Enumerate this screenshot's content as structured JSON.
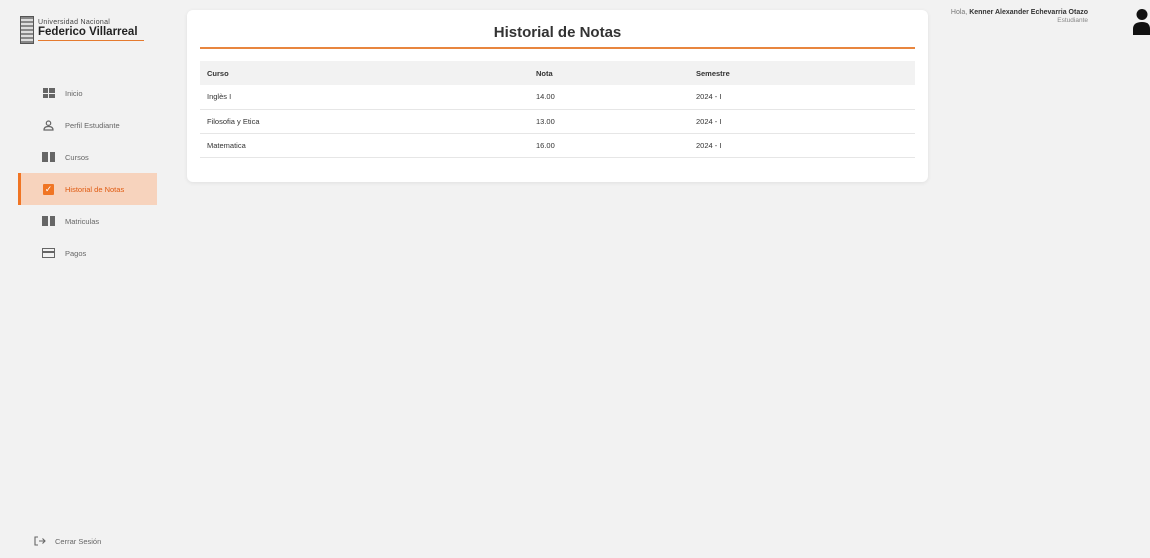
{
  "logo": {
    "line1": "Universidad Nacional",
    "line2": "Federico Villarreal"
  },
  "sidebar": {
    "items": [
      {
        "label": "Inicio",
        "icon": "grid-icon"
      },
      {
        "label": "Perfil Estudiante",
        "icon": "user-icon"
      },
      {
        "label": "Cursos",
        "icon": "book-icon"
      },
      {
        "label": "Historial de Notas",
        "icon": "check-icon",
        "active": true
      },
      {
        "label": "Matriculas",
        "icon": "book-icon"
      },
      {
        "label": "Pagos",
        "icon": "card-icon"
      }
    ],
    "logout": "Cerrar Sesión"
  },
  "header": {
    "greeting": "Hola,",
    "user_name": "Kenner Alexander Echevarria Otazo",
    "role": "Estudiante"
  },
  "main": {
    "title": "Historial de Notas",
    "table": {
      "headers": [
        "Curso",
        "Nota",
        "Semestre"
      ],
      "rows": [
        [
          "Inglès I",
          "14.00",
          "2024 - I"
        ],
        [
          "Filosofia y Etica",
          "13.00",
          "2024 - I"
        ],
        [
          "Matematica",
          "16.00",
          "2024 - I"
        ]
      ]
    }
  },
  "colors": {
    "accent": "#f07524",
    "active_bg": "#f7d3bd",
    "background": "#f2f2f2"
  }
}
